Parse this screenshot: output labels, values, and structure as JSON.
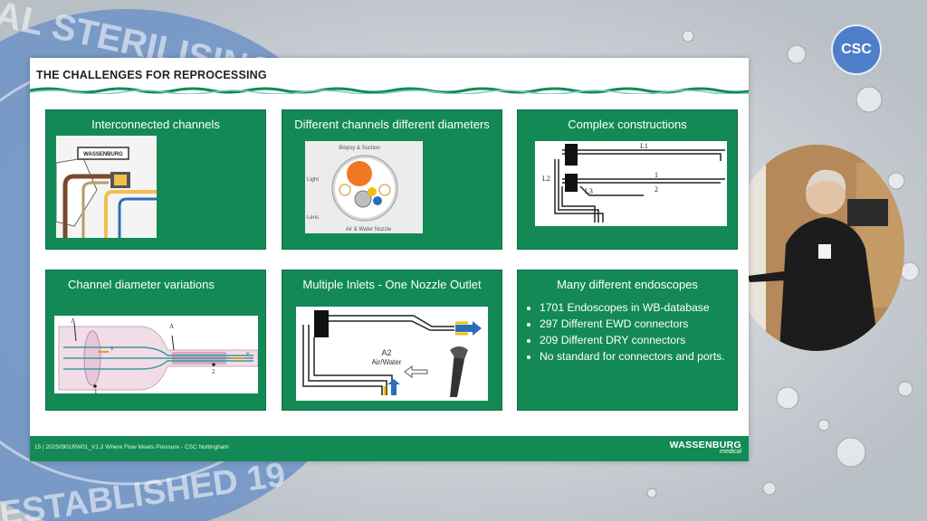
{
  "background": {
    "seal_text_top": "AL STERILISING",
    "seal_text_bottom": "ESTABLISHED 19"
  },
  "badge": {
    "label": "CSC"
  },
  "slide": {
    "title": "THE CHALLENGES FOR REPROCESSING",
    "panels": [
      {
        "title": "Interconnected channels",
        "figure_label": "WASSENBURG"
      },
      {
        "title": "Different channels different diameters",
        "figure_labels": {
          "top": "Biopsy & Suction",
          "left_upper": "Light",
          "left_lower": "Lens",
          "bottom": "Air & Water Nozzle"
        }
      },
      {
        "title": "Complex constructions",
        "figure_labels": {
          "l1": "L1",
          "l2": "L2",
          "l3": "L3",
          "n1": "1",
          "n2": "2"
        }
      },
      {
        "title": "Channel diameter variations",
        "figure_labels": {
          "a1": "A",
          "a2": "A",
          "v1": "v",
          "v2": "v",
          "p1": "1",
          "p2": "2"
        }
      },
      {
        "title": "Multiple Inlets - One Nozzle Outlet",
        "figure_labels": {
          "center_line1": "A2",
          "center_line2": "Air/Water"
        }
      },
      {
        "title": "Many different endoscopes",
        "bullets": [
          "1701 Endoscopes in WB-database",
          "297 Different EWD connectors",
          "209 Different DRY connectors",
          "No standard for connectors and ports."
        ]
      }
    ],
    "footer": {
      "text": "15 | 20250901RW01_V1.2 Where Flow Meets Pressure - CSC Nottingham",
      "logo_main": "WASSENBURG",
      "logo_sub": "medical"
    }
  },
  "colors": {
    "panel_green": "#138a55",
    "badge_blue": "#4f7fc8"
  }
}
